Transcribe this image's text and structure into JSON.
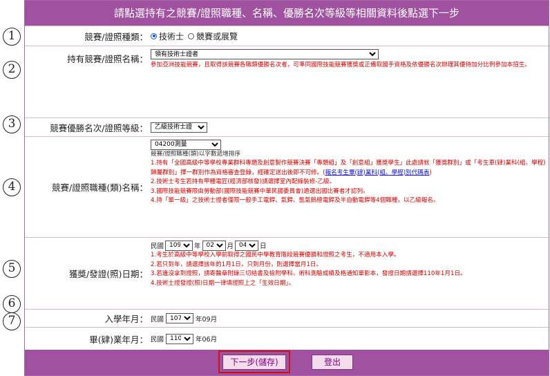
{
  "header": {
    "title": "請點選持有之競賽/證照職種、名稱、優勝名次等級等相關資料後點選下一步"
  },
  "markers": [
    "1",
    "2",
    "3",
    "4",
    "5",
    "6",
    "7"
  ],
  "fields": {
    "type": {
      "label": "競賽/證照種類：",
      "options": [
        {
          "text": "技術士",
          "checked": true
        },
        {
          "text": "競賽或展覽",
          "checked": false
        }
      ]
    },
    "name": {
      "label": "持有競賽/證照名稱：",
      "selected": "領有技術士證者",
      "note": "參加亞洲技能競賽，且取得該競賽各職類優勝名次者，可準同國際技能競賽獲獎或正備取國手資格及依優勝名次辦理其優待加分比例參加本招生。"
    },
    "rank": {
      "label": "競賽優勝名次/證照等級：",
      "selected": "乙級技術士證"
    },
    "category": {
      "label": "競賽/證照職種(類)名稱：",
      "selected": "04200測量",
      "sort_note": "競賽/證照職種(類)以字數遞增排序",
      "note1a": "1.持有「全國高級中等學校專業群科專題及創意製作競賽決賽「專題組」及「創意組」獲獎學生」此處請就「獲獎群別」或「考生車(肄)業科(組、學程)歸屬群別」擇一群別作為資格審查登錄，經確定送出後即不可修。(",
      "link": "報名考生畢(肄)業科(組、學程)別代碼表",
      "note1b": ")",
      "note2": "2.技術士考生若持有甲種電匠(經濟部核發)請選擇室內配線裝修-乙級。",
      "note3": "3.國際技能競賽限由勞動部(國際技能競賽中華民國委員會)遴選出國比賽者才認列。",
      "note4": "4.持「單一級」之技術士證者僅限一般手工電銲、氣銲、氬氣鎢極電銲及半自動電銲等4個職種，以乙級報名。"
    },
    "date": {
      "label": "獲獎/發證(照)日期：",
      "prefix": "民國",
      "year": "109",
      "year_unit": "年",
      "month": "02",
      "month_unit": "月",
      "day": "04",
      "day_unit": "日",
      "note1": "1.考生於高級中等學校入學前取得之國民中學教育階段競賽優勝和證照之考生，不適用本入學。",
      "note2": "2.若只到年，請選擇該年的1月1日，只到月份，則選擇當月1日。",
      "note3": "3.若遺沒拿到證照，請寄醫章附錄三切結書及檢附學科、術科測驗成績及格通知單影本，發證日期請選擇110年1月1日。",
      "note4": "4.技術士證發證(照)日期一律填證照上之「生效日期」。"
    },
    "enroll": {
      "label": "入學年月：",
      "prefix": "民國",
      "year": "107",
      "suffix": "年09月"
    },
    "grad": {
      "label": "畢(肄)業年月：",
      "prefix": "民國",
      "year": "110",
      "suffix": "年06月"
    }
  },
  "buttons": {
    "next": "下一步(儲存)",
    "logout": "登出"
  },
  "colors": {
    "header_bg": "#a052a0",
    "note_red": "#d40000",
    "highlight_border": "#d01010"
  }
}
